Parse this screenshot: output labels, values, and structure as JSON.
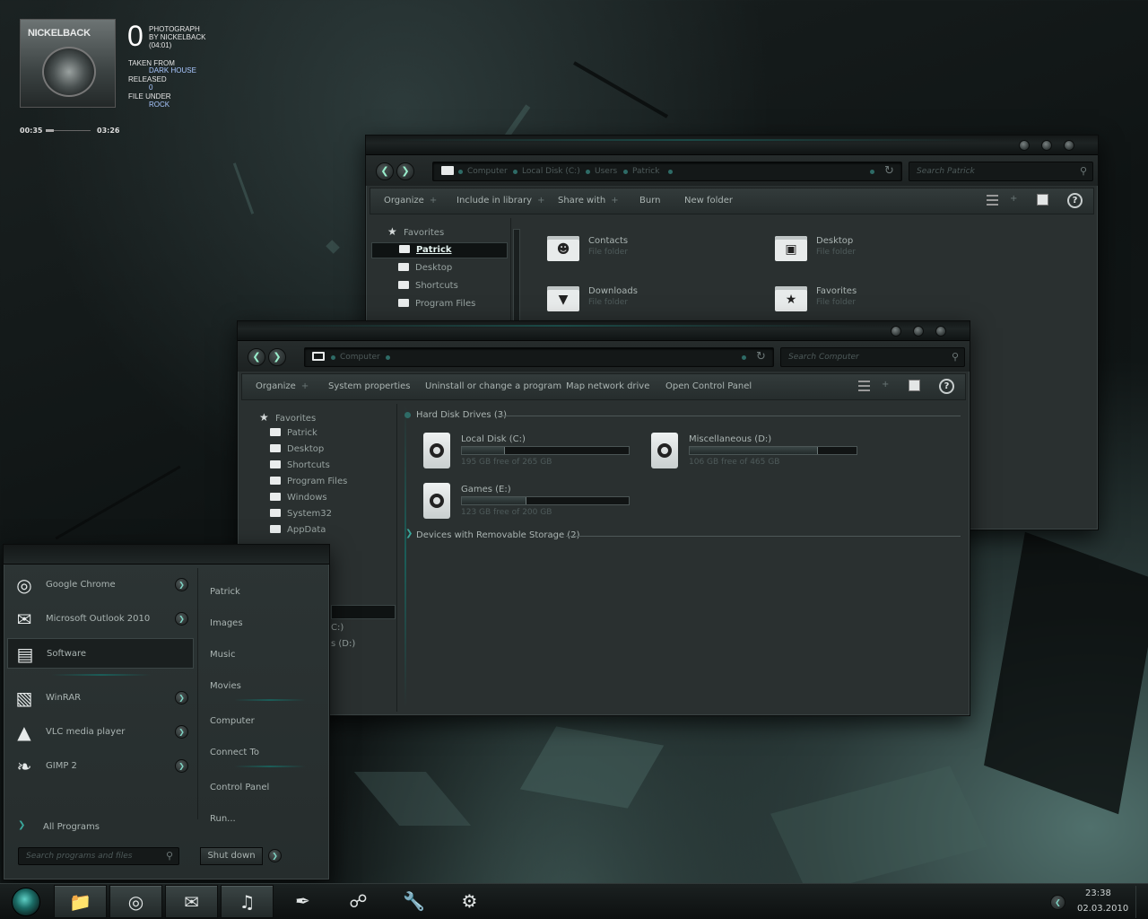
{
  "music_widget": {
    "album_art_text": "NICKELBACK",
    "track_number": "0",
    "title_line1": "PHOTOGRAPH",
    "title_line2": "BY NICKELBACK",
    "title_line3": "(04:01)",
    "taken_from_label": "TAKEN FROM",
    "album": "DARK HOUSE",
    "released_label": "RELEASED",
    "released_value": "0",
    "file_under_label": "FILE UNDER",
    "genre": "ROCK",
    "elapsed": "00:35",
    "total": "03:26",
    "progress_fraction": 0.17
  },
  "explorer_patrick": {
    "crumbs": [
      "Computer",
      "Local Disk (C:)",
      "Users",
      "Patrick"
    ],
    "search_placeholder": "Search Patrick",
    "toolbar": [
      "Organize",
      "Include in library",
      "Share with",
      "Burn",
      "New folder"
    ],
    "toolbar_plus": [
      "+",
      "+",
      "+",
      "",
      ""
    ],
    "nav": {
      "favorites": "Favorites",
      "items": [
        "Patrick",
        "Desktop",
        "Shortcuts",
        "Program Files"
      ]
    },
    "tiles": [
      {
        "name": "Contacts",
        "type": "File folder",
        "icon": "contacts-icon"
      },
      {
        "name": "Desktop",
        "type": "File folder",
        "icon": "desktop-icon"
      },
      {
        "name": "Downloads",
        "type": "File folder",
        "icon": "downloads-icon"
      },
      {
        "name": "Favorites",
        "type": "File folder",
        "icon": "favorites-star-icon"
      }
    ]
  },
  "explorer_computer": {
    "crumbs": [
      "Computer"
    ],
    "search_placeholder": "Search Computer",
    "toolbar": [
      "Organize",
      "System properties",
      "Uninstall or change a program",
      "Map network drive",
      "Open Control Panel"
    ],
    "toolbar_plus": [
      "+",
      "",
      "",
      "",
      ""
    ],
    "nav": {
      "favorites": "Favorites",
      "items": [
        "Patrick",
        "Desktop",
        "Shortcuts",
        "Program Files",
        "Windows",
        "System32",
        "AppData"
      ],
      "partial_items": [
        "C:)",
        "s (D:)"
      ]
    },
    "hard_disk_group": "Hard Disk Drives (3)",
    "removable_group": "Devices with Removable Storage (2)",
    "drives": [
      {
        "name": "Local Disk (C:)",
        "free": "195 GB free of 265 GB",
        "used_fraction": 0.26
      },
      {
        "name": "Miscellaneous (D:)",
        "free": "106 GB free of 465 GB",
        "used_fraction": 0.77
      },
      {
        "name": "Games (E:)",
        "free": "123 GB free of 200 GB",
        "used_fraction": 0.385
      }
    ]
  },
  "start_menu": {
    "programs": [
      {
        "label": "Google Chrome",
        "icon": "chrome-icon",
        "has_arrow": true
      },
      {
        "label": "Microsoft Outlook 2010",
        "icon": "mail-icon",
        "has_arrow": true
      },
      {
        "label": "Software",
        "icon": "software-icon",
        "has_arrow": false
      },
      {
        "label": "WinRAR",
        "icon": "winrar-icon",
        "has_arrow": true
      },
      {
        "label": "VLC media player",
        "icon": "vlc-icon",
        "has_arrow": true
      },
      {
        "label": "GIMP 2",
        "icon": "gimp-icon",
        "has_arrow": true
      }
    ],
    "all_programs": "All Programs",
    "links": [
      "Patrick",
      "Images",
      "Music",
      "Movies",
      "Computer",
      "Connect To",
      "Control Panel",
      "Run..."
    ],
    "search_placeholder": "Search programs and files",
    "shutdown": "Shut down"
  },
  "taskbar": {
    "time": "23:38",
    "date": "02.03.2010",
    "buttons": [
      "explorer-icon",
      "chrome-icon",
      "mail-icon",
      "music-note-icon",
      "feather-icon",
      "link-icon",
      "wrench-icon",
      "gear-icon"
    ]
  },
  "colors": {
    "accent": "#2e6b66",
    "window_bg": "#2a3030",
    "text": "#aab4b2",
    "muted_text": "#4e5a5a"
  }
}
